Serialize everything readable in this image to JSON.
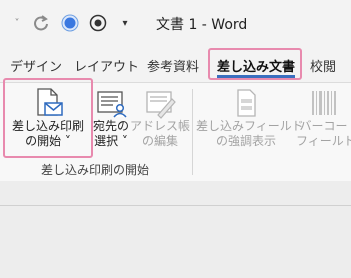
{
  "window": {
    "title": "文書 1  -  Word"
  },
  "quick_access": {
    "undo_icon": "undo-icon",
    "redo_icon": "redo-icon",
    "circle_icon": "blue-circle-icon",
    "target_icon": "target-icon",
    "menu_icon": "customize-qat-icon"
  },
  "tabs": [
    {
      "label": "デザイン"
    },
    {
      "label": "レイアウト"
    },
    {
      "label": "参考資料"
    },
    {
      "label": "差し込み文書"
    },
    {
      "label": "校閲"
    }
  ],
  "ribbon": {
    "start_mailmerge": {
      "line1": "差し込み印刷",
      "line2": "の開始 ˅"
    },
    "select_recipients": {
      "line1": "宛先の",
      "line2": "選択 ˅"
    },
    "edit_list": {
      "line1": "アドレス帳",
      "line2": "の編集"
    },
    "highlight_fields": {
      "line1": "差し込みフィールド",
      "line2": "の強調表示"
    },
    "barcode": {
      "line1": "バーコー",
      "line2": "フィールドの"
    },
    "group_label": "差し込み印刷の開始"
  },
  "colors": {
    "highlight_border": "#e88aae",
    "active_tab_underline": "#3a6fbf"
  }
}
